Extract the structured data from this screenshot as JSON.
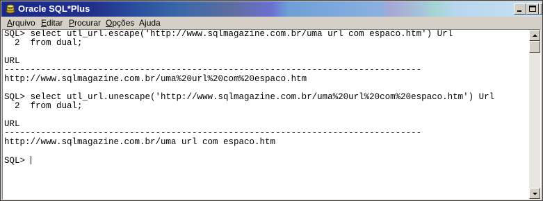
{
  "window": {
    "title": "Oracle SQL*Plus",
    "icon": "sqlplus-app-icon",
    "buttons": [
      "minimize",
      "maximize",
      "close"
    ]
  },
  "menu": [
    {
      "pre": "",
      "acc": "A",
      "post": "rquivo"
    },
    {
      "pre": "",
      "acc": "E",
      "post": "ditar"
    },
    {
      "pre": "",
      "acc": "P",
      "post": "rocurar"
    },
    {
      "pre": "",
      "acc": "O",
      "post": "pções"
    },
    {
      "pre": "A",
      "acc": "j",
      "post": "uda"
    }
  ],
  "console": {
    "lines": [
      "SQL> select utl_url.escape('http://www.sqlmagazine.com.br/uma url com espaco.htm') Url",
      "  2  from dual;",
      "",
      "URL",
      "--------------------------------------------------------------------------------",
      "http://www.sqlmagazine.com.br/uma%20url%20com%20espaco.htm",
      "",
      "SQL> select utl_url.unescape('http://www.sqlmagazine.com.br/uma%20url%20com%20espaco.htm') Url",
      "  2  from dual;",
      "",
      "URL",
      "--------------------------------------------------------------------------------",
      "http://www.sqlmagazine.com.br/uma url com espaco.htm",
      "",
      "SQL> "
    ]
  },
  "colors": {
    "titlebar_start": "#1a2a8a",
    "titlebar_end": "#c8e0f4",
    "chrome": "#d4d0c8",
    "console_bg": "#ffffff",
    "console_text": "#000000"
  }
}
